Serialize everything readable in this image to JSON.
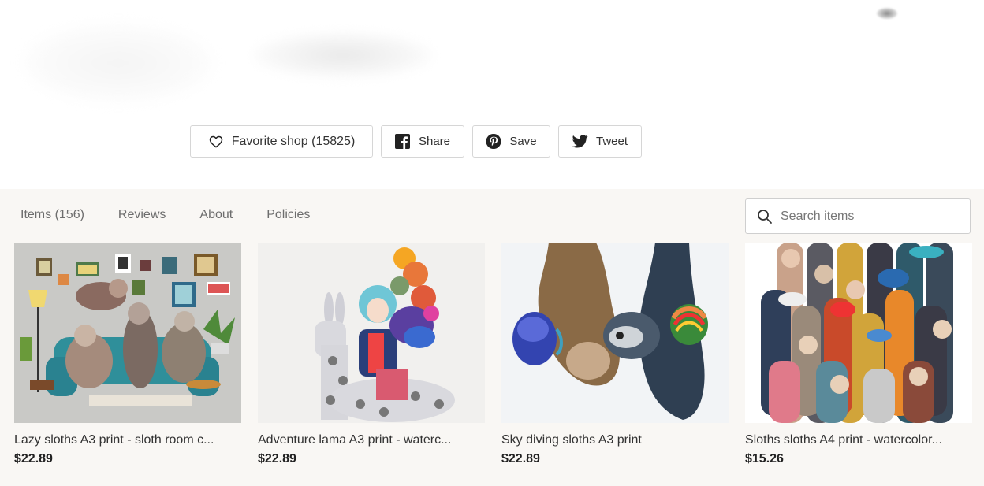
{
  "actions": {
    "favorite_label": "Favorite shop (15825)",
    "share_label": "Share",
    "save_label": "Save",
    "tweet_label": "Tweet"
  },
  "tabs": [
    {
      "label": "Items (156)"
    },
    {
      "label": "Reviews"
    },
    {
      "label": "About"
    },
    {
      "label": "Policies"
    }
  ],
  "search": {
    "placeholder": "Search items"
  },
  "listings": [
    {
      "title": "Lazy sloths A3 print - sloth room c...",
      "price": "$22.89",
      "image": "sloths-on-sofa-illustration"
    },
    {
      "title": "Adventure lama A3 print - waterc...",
      "price": "$22.89",
      "image": "girl-riding-llama-watercolor"
    },
    {
      "title": "Sky diving sloths A3 print",
      "price": "$22.89",
      "image": "hanging-sloths-watercolor"
    },
    {
      "title": "Sloths sloths A4 print - watercolor...",
      "price": "$15.26",
      "image": "crowd-of-sloths-watercolor"
    }
  ],
  "colors": {
    "panel_bg": "#f9f7f4",
    "border": "#d6d6d6"
  }
}
